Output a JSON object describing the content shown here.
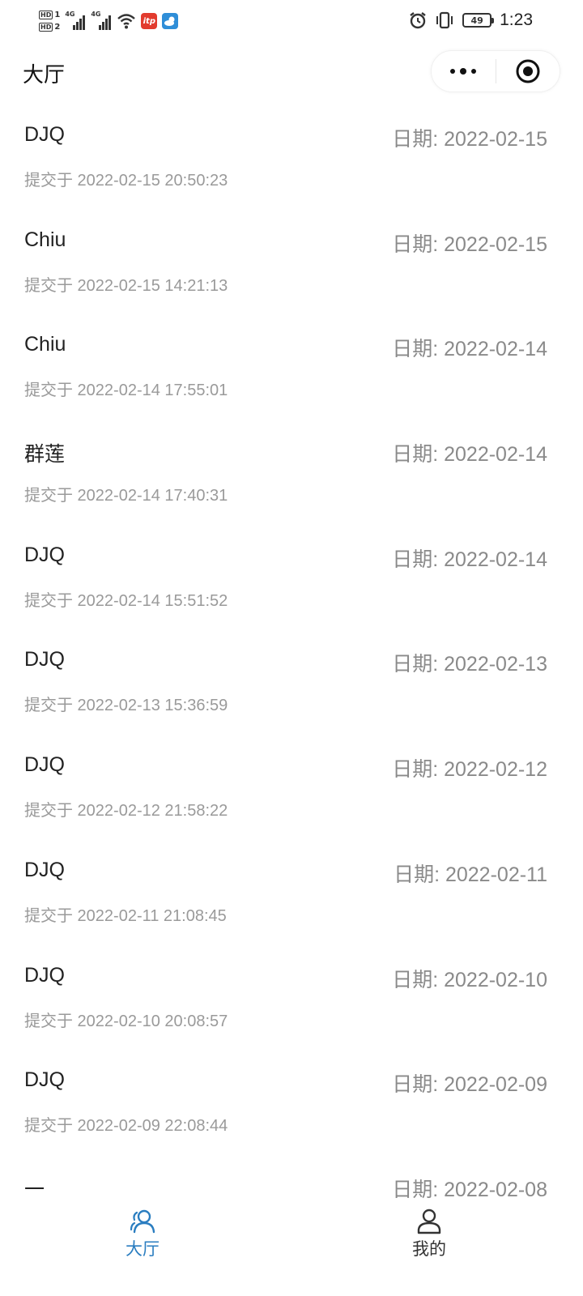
{
  "status_bar": {
    "hd1": "HD",
    "hd1_sub": "1",
    "hd2": "HD",
    "hd2_sub": "2",
    "net1": "4G",
    "net2": "4G",
    "app_red_label": "itp",
    "battery": "49",
    "time": "1:23"
  },
  "header": {
    "title": "大厅"
  },
  "records": [
    {
      "name": "DJQ",
      "date": "日期: 2022-02-15",
      "submitted": "提交于 2022-02-15 20:50:23"
    },
    {
      "name": "Chiu",
      "date": "日期: 2022-02-15",
      "submitted": "提交于 2022-02-15 14:21:13"
    },
    {
      "name": "Chiu",
      "date": "日期: 2022-02-14",
      "submitted": "提交于 2022-02-14 17:55:01"
    },
    {
      "name": "群莲",
      "date": "日期: 2022-02-14",
      "submitted": "提交于 2022-02-14 17:40:31"
    },
    {
      "name": "DJQ",
      "date": "日期: 2022-02-14",
      "submitted": "提交于 2022-02-14 15:51:52"
    },
    {
      "name": "DJQ",
      "date": "日期: 2022-02-13",
      "submitted": "提交于 2022-02-13 15:36:59"
    },
    {
      "name": "DJQ",
      "date": "日期: 2022-02-12",
      "submitted": "提交于 2022-02-12 21:58:22"
    },
    {
      "name": "DJQ",
      "date": "日期: 2022-02-11",
      "submitted": "提交于 2022-02-11 21:08:45"
    },
    {
      "name": "DJQ",
      "date": "日期: 2022-02-10",
      "submitted": "提交于 2022-02-10 20:08:57"
    },
    {
      "name": "DJQ",
      "date": "日期: 2022-02-09",
      "submitted": "提交于 2022-02-09 22:08:44"
    },
    {
      "name": "一",
      "date": "日期: 2022-02-08",
      "submitted": ""
    }
  ],
  "tabs": [
    {
      "label": "大厅",
      "icon": "users-icon",
      "active": true
    },
    {
      "label": "我的",
      "icon": "user-icon",
      "active": false
    }
  ],
  "colors": {
    "accent": "#2a7dc0",
    "date_text": "#8a8a8a",
    "meta_text": "#9a9a9a"
  }
}
